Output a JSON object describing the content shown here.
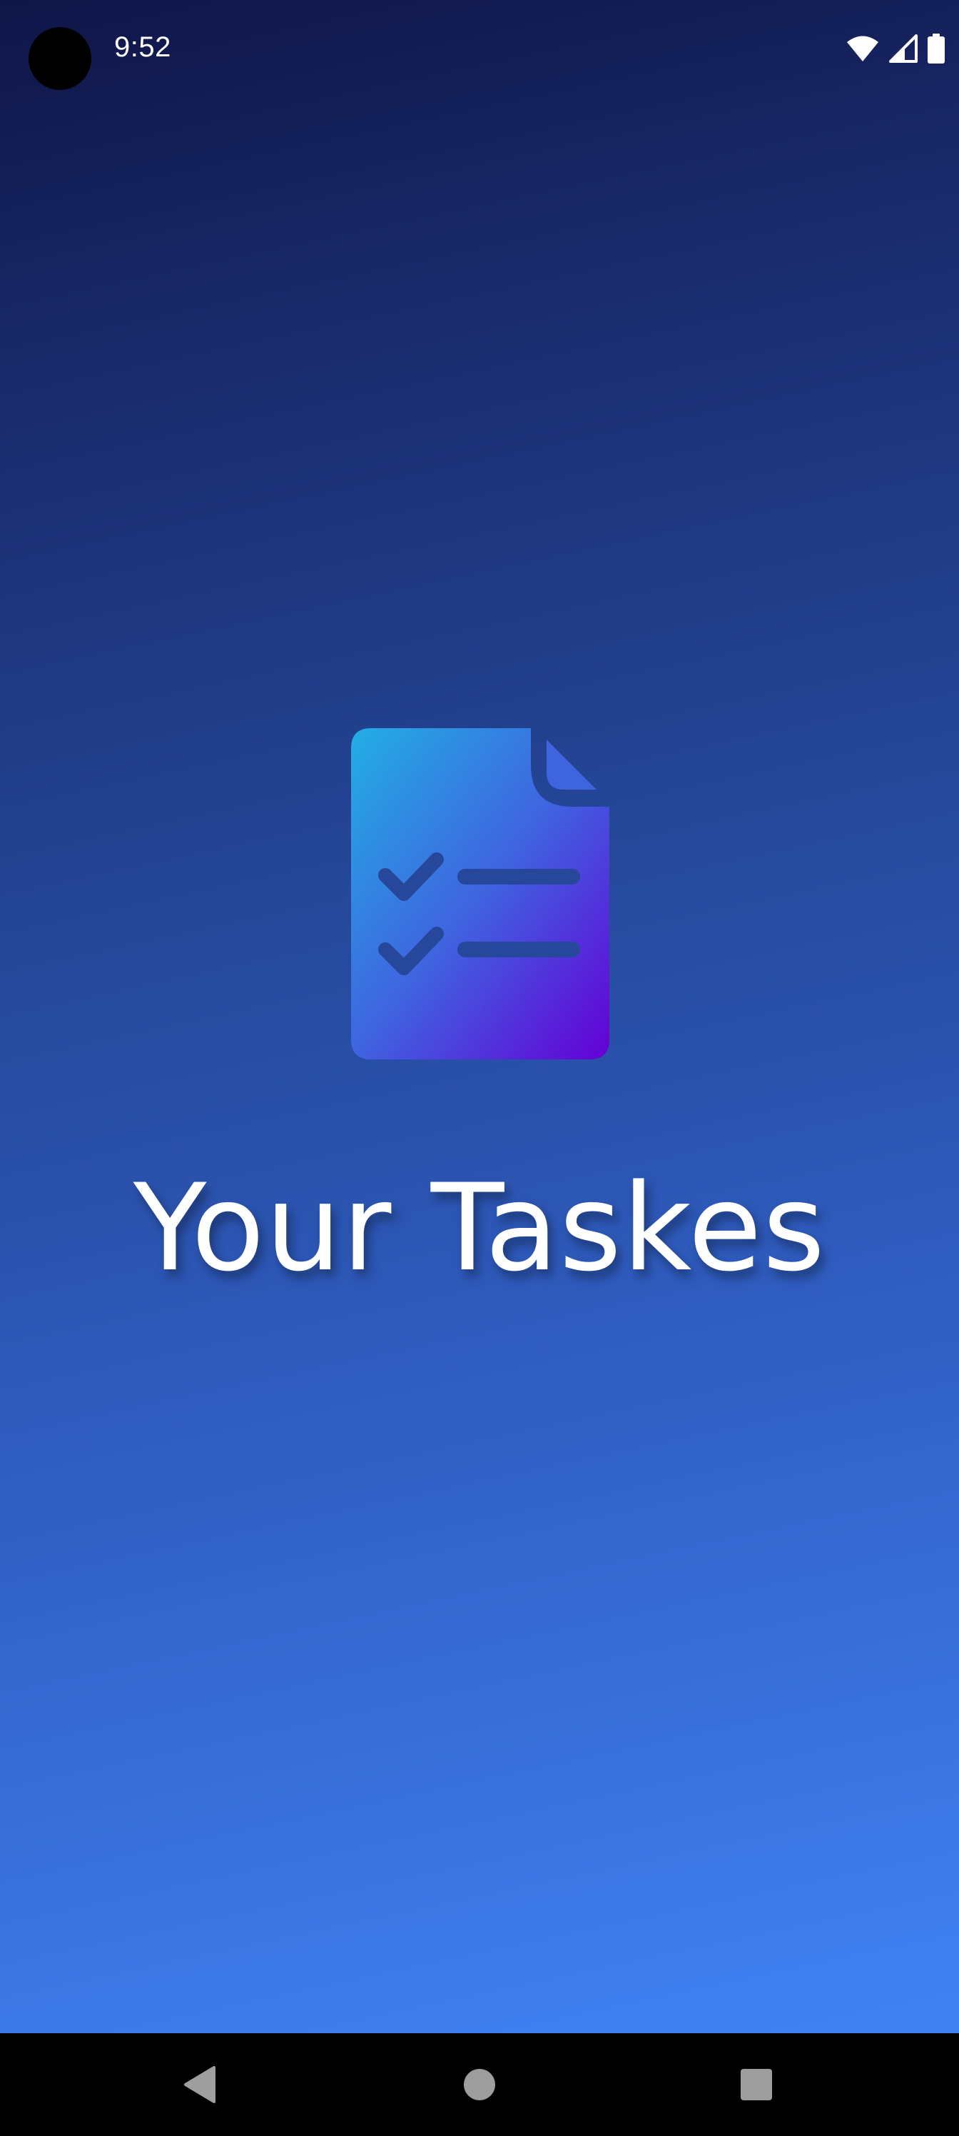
{
  "status_bar": {
    "time": "9:52",
    "icons": [
      "wifi-icon",
      "signal-icon",
      "battery-icon"
    ]
  },
  "splash": {
    "logo_icon": "task-document-checklist-icon",
    "title": "Your Taskes"
  },
  "nav_bar": {
    "buttons": [
      "back-icon",
      "home-icon",
      "recents-icon"
    ]
  },
  "colors": {
    "background_top": "#0f1547",
    "background_bottom": "#4287fb",
    "logo_gradient_start": "#22aee4",
    "logo_gradient_end": "#6400d6",
    "logo_marks": "#26479a",
    "title": "#ffffff",
    "nav_bar": "#000000",
    "nav_icons": "#9e9e9e"
  }
}
